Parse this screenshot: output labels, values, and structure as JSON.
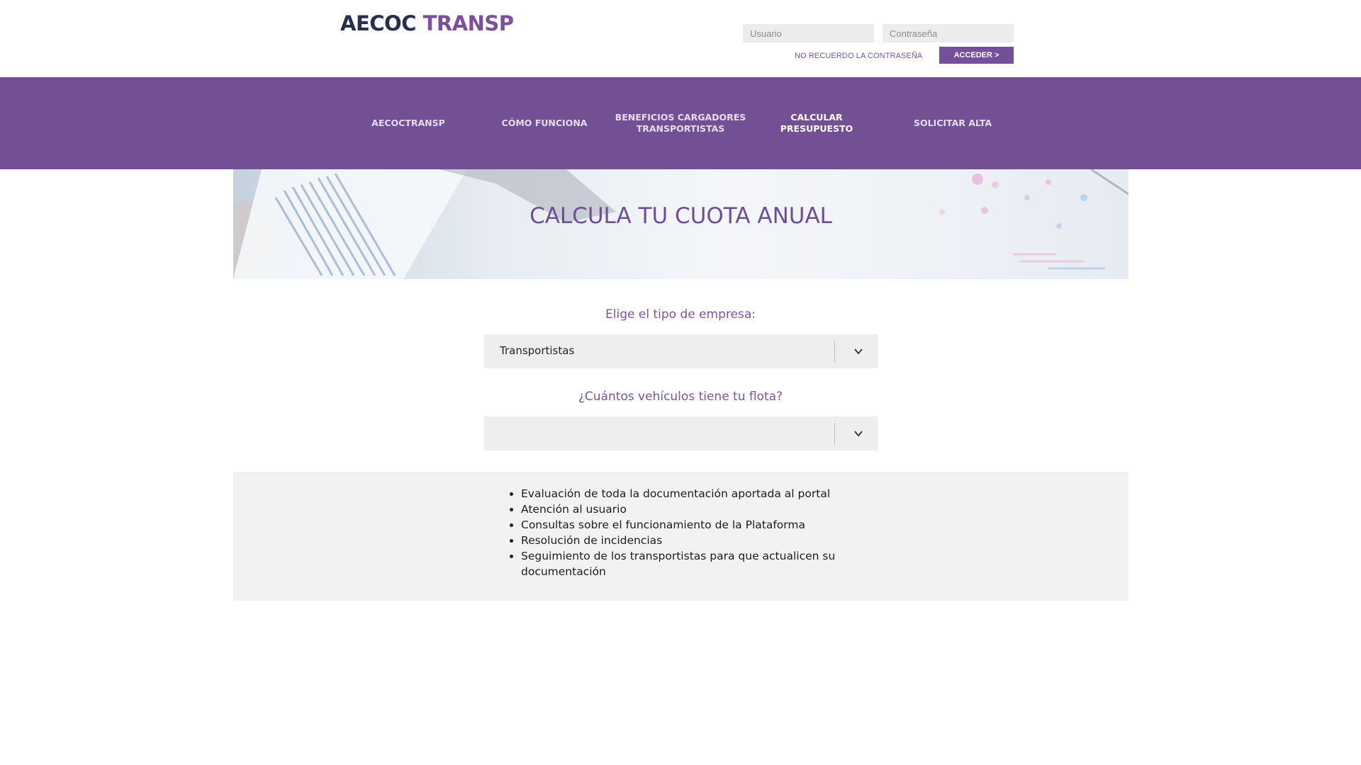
{
  "brand": {
    "logo_part1": "AECOC",
    "logo_part2": "TRANSP",
    "colors": {
      "primary": "#734f93",
      "logo_dark": "#2b2f4e",
      "logo_purple": "#7b4f9b"
    }
  },
  "login": {
    "user_placeholder": "Usuario",
    "password_placeholder": "Contraseña",
    "forgot_label": "NO RECUERDO LA CONTRASEÑA",
    "access_label": "ACCEDER >"
  },
  "nav": {
    "items": [
      {
        "label": "AECOCTRANSP"
      },
      {
        "label": "CÓMO FUNCIONA"
      },
      {
        "label": "BENEFICIOS CARGADORES\nTRANSPORTISTAS"
      },
      {
        "label": "CALCULAR\nPRESUPUESTO"
      },
      {
        "label": "SOLICITAR ALTA"
      }
    ],
    "active_index": 3
  },
  "banner": {
    "title": "CALCULA TU CUOTA ANUAL"
  },
  "form": {
    "company_type_label": "Elige el tipo de empresa:",
    "company_type_value": "Transportistas",
    "fleet_label": "¿Cuántos vehículos tiene tu flota?",
    "fleet_value": "",
    "chevron_icon": "chevron-down-icon"
  },
  "info": {
    "items": [
      "Evaluación de toda la documentación aportada al portal",
      "Atención al usuario",
      "Consultas sobre el funcionamiento de la Plataforma",
      "Resolución de incidencias",
      "Seguimiento de los transportistas para que actualicen su documentación"
    ]
  }
}
